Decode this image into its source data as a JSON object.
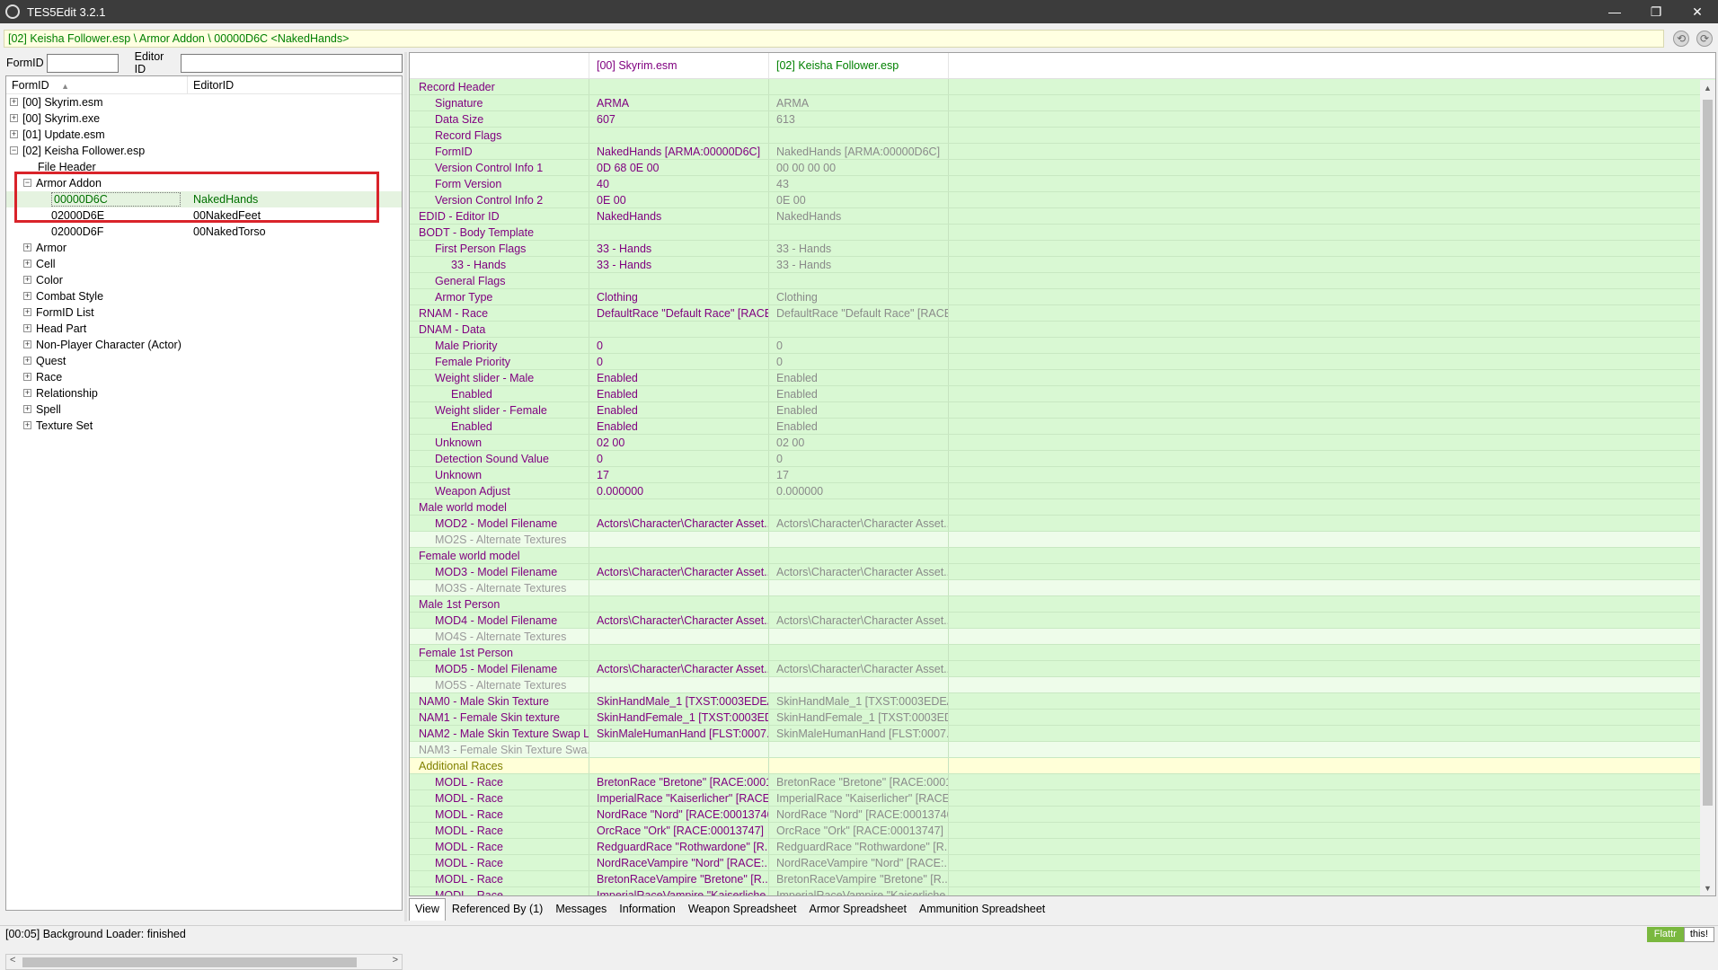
{
  "window": {
    "title": "TES5Edit 3.2.1",
    "minimize": "—",
    "restore": "❐",
    "close": "✕"
  },
  "pathbar": {
    "text": "[02] Keisha Follower.esp \\ Armor Addon \\ 00000D6C <NakedHands>",
    "back": "⟲",
    "forward": "⟳"
  },
  "filter": {
    "formid_label": "FormID",
    "editorid_label": "Editor ID",
    "formid_value": "",
    "editorid_value": ""
  },
  "tree": {
    "headers": [
      "FormID",
      "EditorID"
    ],
    "sort_indicator": "▲",
    "rows": [
      {
        "indent": 0,
        "exp": "+",
        "col1": "[00] Skyrim.esm",
        "col2": ""
      },
      {
        "indent": 0,
        "exp": "+",
        "col1": "[00] Skyrim.exe",
        "col2": ""
      },
      {
        "indent": 0,
        "exp": "+",
        "col1": "[01] Update.esm",
        "col2": ""
      },
      {
        "indent": 0,
        "exp": "−",
        "col1": "[02] Keisha Follower.esp",
        "col2": ""
      },
      {
        "indent": 1,
        "exp": "",
        "col1": "File Header",
        "col2": ""
      },
      {
        "indent": 1,
        "exp": "−",
        "col1": "Armor Addon",
        "col2": ""
      },
      {
        "indent": 2,
        "exp": "",
        "col1": "00000D6C",
        "col2": "NakedHands",
        "selected": true
      },
      {
        "indent": 2,
        "exp": "",
        "col1": "02000D6E",
        "col2": "00NakedFeet"
      },
      {
        "indent": 2,
        "exp": "",
        "col1": "02000D6F",
        "col2": "00NakedTorso"
      },
      {
        "indent": 1,
        "exp": "+",
        "col1": "Armor",
        "col2": ""
      },
      {
        "indent": 1,
        "exp": "+",
        "col1": "Cell",
        "col2": ""
      },
      {
        "indent": 1,
        "exp": "+",
        "col1": "Color",
        "col2": ""
      },
      {
        "indent": 1,
        "exp": "+",
        "col1": "Combat Style",
        "col2": ""
      },
      {
        "indent": 1,
        "exp": "+",
        "col1": "FormID List",
        "col2": ""
      },
      {
        "indent": 1,
        "exp": "+",
        "col1": "Head Part",
        "col2": ""
      },
      {
        "indent": 1,
        "exp": "+",
        "col1": "Non-Player Character (Actor)",
        "col2": ""
      },
      {
        "indent": 1,
        "exp": "+",
        "col1": "Quest",
        "col2": ""
      },
      {
        "indent": 1,
        "exp": "+",
        "col1": "Race",
        "col2": ""
      },
      {
        "indent": 1,
        "exp": "+",
        "col1": "Relationship",
        "col2": ""
      },
      {
        "indent": 1,
        "exp": "+",
        "col1": "Spell",
        "col2": ""
      },
      {
        "indent": 1,
        "exp": "+",
        "col1": "Texture Set",
        "col2": ""
      }
    ],
    "scroll_left": "<",
    "scroll_right": ">"
  },
  "grid": {
    "headers": [
      "",
      "[00] Skyrim.esm",
      "[02] Keisha Follower.esp"
    ],
    "rows": [
      {
        "level": 0,
        "k": "Record Header",
        "v1": "",
        "v2": ""
      },
      {
        "level": 1,
        "k": "Signature",
        "v1": "ARMA",
        "v2": "ARMA"
      },
      {
        "level": 1,
        "k": "Data Size",
        "v1": "607",
        "v2": "613"
      },
      {
        "level": 1,
        "k": "Record Flags",
        "v1": "",
        "v2": ""
      },
      {
        "level": 1,
        "k": "FormID",
        "v1": "NakedHands [ARMA:00000D6C]",
        "v2": "NakedHands [ARMA:00000D6C]"
      },
      {
        "level": 1,
        "k": "Version Control Info 1",
        "v1": "0D 68 0E 00",
        "v2": "00 00 00 00"
      },
      {
        "level": 1,
        "k": "Form Version",
        "v1": "40",
        "v2": "43"
      },
      {
        "level": 1,
        "k": "Version Control Info 2",
        "v1": "0E 00",
        "v2": "0E 00"
      },
      {
        "level": 0,
        "k": "EDID - Editor ID",
        "v1": "NakedHands",
        "v2": "NakedHands"
      },
      {
        "level": 0,
        "k": "BODT - Body Template",
        "v1": "",
        "v2": ""
      },
      {
        "level": 1,
        "k": "First Person Flags",
        "v1": "33 - Hands",
        "v2": "33 - Hands"
      },
      {
        "level": 2,
        "k": "33 - Hands",
        "v1": "33 - Hands",
        "v2": "33 - Hands"
      },
      {
        "level": 1,
        "k": "General Flags",
        "v1": "",
        "v2": ""
      },
      {
        "level": 1,
        "k": "Armor Type",
        "v1": "Clothing",
        "v2": "Clothing"
      },
      {
        "level": 0,
        "k": "RNAM - Race",
        "v1": "DefaultRace \"Default Race\" [RACE...",
        "v2": "DefaultRace \"Default Race\" [RACE..."
      },
      {
        "level": 0,
        "k": "DNAM - Data",
        "v1": "",
        "v2": ""
      },
      {
        "level": 1,
        "k": "Male Priority",
        "v1": "0",
        "v2": "0"
      },
      {
        "level": 1,
        "k": "Female Priority",
        "v1": "0",
        "v2": "0"
      },
      {
        "level": 1,
        "k": "Weight slider - Male",
        "v1": "Enabled",
        "v2": "Enabled"
      },
      {
        "level": 2,
        "k": "Enabled",
        "v1": "Enabled",
        "v2": "Enabled"
      },
      {
        "level": 1,
        "k": "Weight slider - Female",
        "v1": "Enabled",
        "v2": "Enabled"
      },
      {
        "level": 2,
        "k": "Enabled",
        "v1": "Enabled",
        "v2": "Enabled"
      },
      {
        "level": 1,
        "k": "Unknown",
        "v1": "02 00",
        "v2": "02 00"
      },
      {
        "level": 1,
        "k": "Detection Sound Value",
        "v1": "0",
        "v2": "0"
      },
      {
        "level": 1,
        "k": "Unknown",
        "v1": "17",
        "v2": "17"
      },
      {
        "level": 1,
        "k": "Weapon Adjust",
        "v1": "0.000000",
        "v2": "0.000000"
      },
      {
        "level": 0,
        "k": "Male world model",
        "v1": "",
        "v2": ""
      },
      {
        "level": 1,
        "k": "MOD2 - Model Filename",
        "v1": "Actors\\Character\\Character Asset...",
        "v2": "Actors\\Character\\Character Asset..."
      },
      {
        "level": 1,
        "k": "MO2S - Alternate Textures",
        "v1": "",
        "v2": "",
        "dim": true
      },
      {
        "level": 0,
        "k": "Female world model",
        "v1": "",
        "v2": ""
      },
      {
        "level": 1,
        "k": "MOD3 - Model Filename",
        "v1": "Actors\\Character\\Character Asset...",
        "v2": "Actors\\Character\\Character Asset..."
      },
      {
        "level": 1,
        "k": "MO3S - Alternate Textures",
        "v1": "",
        "v2": "",
        "dim": true
      },
      {
        "level": 0,
        "k": "Male 1st Person",
        "v1": "",
        "v2": ""
      },
      {
        "level": 1,
        "k": "MOD4 - Model Filename",
        "v1": "Actors\\Character\\Character Asset...",
        "v2": "Actors\\Character\\Character Asset..."
      },
      {
        "level": 1,
        "k": "MO4S - Alternate Textures",
        "v1": "",
        "v2": "",
        "dim": true
      },
      {
        "level": 0,
        "k": "Female 1st Person",
        "v1": "",
        "v2": ""
      },
      {
        "level": 1,
        "k": "MOD5 - Model Filename",
        "v1": "Actors\\Character\\Character Asset...",
        "v2": "Actors\\Character\\Character Asset..."
      },
      {
        "level": 1,
        "k": "MO5S - Alternate Textures",
        "v1": "",
        "v2": "",
        "dim": true
      },
      {
        "level": 0,
        "k": "NAM0 - Male Skin Texture",
        "v1": "SkinHandMale_1 [TXST:0003EDEA]",
        "v2": "SkinHandMale_1 [TXST:0003EDEA]"
      },
      {
        "level": 0,
        "k": "NAM1 - Female Skin texture",
        "v1": "SkinHandFemale_1 [TXST:0003ED...",
        "v2": "SkinHandFemale_1 [TXST:0003ED..."
      },
      {
        "level": 0,
        "k": "NAM2 - Male Skin Texture Swap L...",
        "v1": "SkinMaleHumanHand [FLST:0007...",
        "v2": "SkinMaleHumanHand [FLST:0007..."
      },
      {
        "level": 0,
        "k": "NAM3 - Female Skin Texture Swa...",
        "v1": "",
        "v2": "",
        "dim": true
      },
      {
        "level": 0,
        "k": "Additional Races",
        "v1": "",
        "v2": "",
        "yellow": true
      },
      {
        "level": 1,
        "k": "MODL - Race",
        "v1": "BretonRace \"Bretone\" [RACE:0001...",
        "v2": "BretonRace \"Bretone\" [RACE:0001..."
      },
      {
        "level": 1,
        "k": "MODL - Race",
        "v1": "ImperialRace \"Kaiserlicher\" [RACE...",
        "v2": "ImperialRace \"Kaiserlicher\" [RACE..."
      },
      {
        "level": 1,
        "k": "MODL - Race",
        "v1": "NordRace \"Nord\" [RACE:00013746]",
        "v2": "NordRace \"Nord\" [RACE:00013746]"
      },
      {
        "level": 1,
        "k": "MODL - Race",
        "v1": "OrcRace \"Ork\" [RACE:00013747]",
        "v2": "OrcRace \"Ork\" [RACE:00013747]"
      },
      {
        "level": 1,
        "k": "MODL - Race",
        "v1": "RedguardRace \"Rothwardone\" [R...",
        "v2": "RedguardRace \"Rothwardone\" [R..."
      },
      {
        "level": 1,
        "k": "MODL - Race",
        "v1": "NordRaceVampire \"Nord\" [RACE:...",
        "v2": "NordRaceVampire \"Nord\" [RACE:..."
      },
      {
        "level": 1,
        "k": "MODL - Race",
        "v1": "BretonRaceVampire \"Bretone\" [R...",
        "v2": "BretonRaceVampire \"Bretone\" [R..."
      },
      {
        "level": 1,
        "k": "MODL - Race",
        "v1": "ImperialRaceVampire \"Kaiserliche...",
        "v2": "ImperialRaceVampire \"Kaiserliche..."
      }
    ],
    "scroll_up": "▲",
    "scroll_down": "▼"
  },
  "tabs": [
    "View",
    "Referenced By (1)",
    "Messages",
    "Information",
    "Weapon Spreadsheet",
    "Armor Spreadsheet",
    "Ammunition Spreadsheet"
  ],
  "active_tab": "View",
  "status": {
    "text": "[00:05] Background Loader: finished",
    "flattr": "Flattr",
    "flattr_this": "this!"
  }
}
